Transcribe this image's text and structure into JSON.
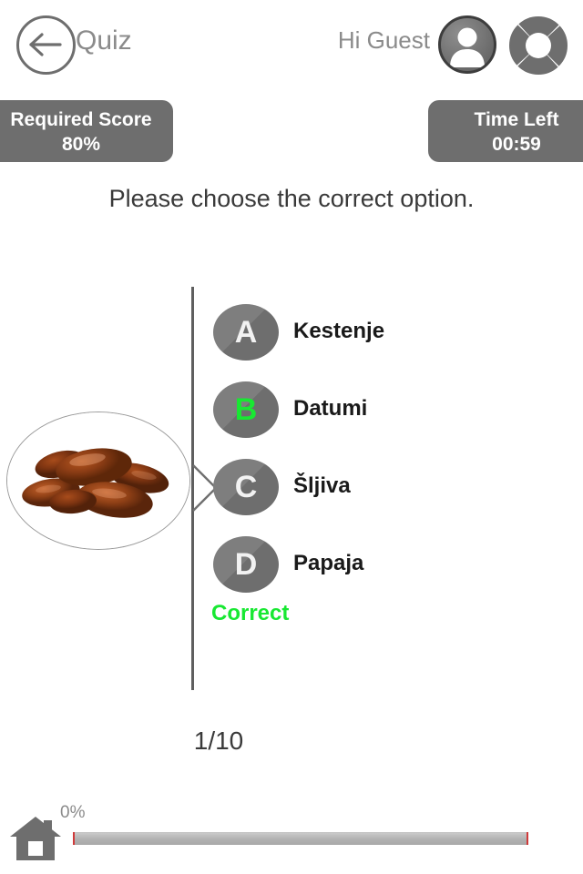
{
  "header": {
    "back_icon": "back-arrow-icon",
    "title": "Quiz",
    "greeting": "Hi Guest",
    "avatar_icon": "user-avatar-icon",
    "menu_icon": "segmented-donut-icon"
  },
  "status": {
    "required_score_label": "Required Score",
    "required_score_value": "80%",
    "time_left_label": "Time Left",
    "time_left_value": "00:59"
  },
  "question": {
    "prompt": "Please choose the correct option.",
    "image_alt": "dates-fruit-image"
  },
  "options": [
    {
      "letter": "A",
      "text": "Kestenje",
      "selected": false
    },
    {
      "letter": "B",
      "text": "Datumi",
      "selected": true
    },
    {
      "letter": "C",
      "text": "Šljiva",
      "selected": false
    },
    {
      "letter": "D",
      "text": "Papaja",
      "selected": false
    }
  ],
  "feedback": {
    "verdict": "Correct"
  },
  "progress": {
    "counter": "1/10",
    "percent_label": "0%",
    "percent_value": 0,
    "home_icon": "home-icon"
  },
  "colors": {
    "accent_green": "#18e832",
    "badge_gray": "#6e6e6e",
    "circle_gray": "#777777",
    "progress_marker_red": "#d03a3a"
  }
}
